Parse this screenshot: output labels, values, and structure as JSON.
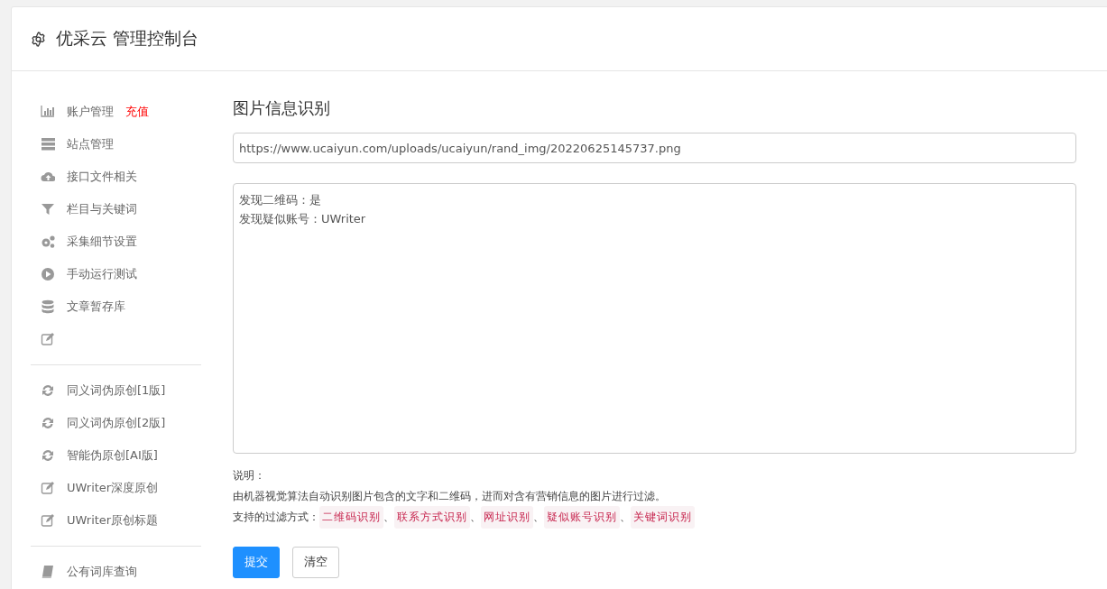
{
  "header": {
    "title": "优采云 管理控制台"
  },
  "sidebar": {
    "groups": [
      {
        "items": [
          {
            "kind": "link",
            "label": "账户管理",
            "badge": "充值"
          },
          {
            "kind": "link",
            "label": "站点管理"
          },
          {
            "kind": "link",
            "label": "接口文件相关"
          },
          {
            "kind": "link",
            "label": "栏目与关键词"
          },
          {
            "kind": "link",
            "label": "采集细节设置"
          },
          {
            "kind": "link",
            "label": "手动运行测试"
          },
          {
            "kind": "link",
            "label": "文章暂存库"
          },
          {
            "kind": "icon"
          }
        ]
      },
      {
        "items": [
          {
            "kind": "link",
            "label": "同义词伪原创[1版]"
          },
          {
            "kind": "link",
            "label": "同义词伪原创[2版]"
          },
          {
            "kind": "link",
            "label": "智能伪原创[AI版]"
          },
          {
            "kind": "link",
            "label": "UWriter深度原创"
          },
          {
            "kind": "link",
            "label": "UWriter原创标题"
          }
        ]
      },
      {
        "items": [
          {
            "kind": "link",
            "label": "公有词库查询"
          }
        ]
      }
    ]
  },
  "main": {
    "title": "图片信息识别",
    "url_field": {
      "value": "https://www.ucaiyun.com/uploads/ucaiyun/rand_img/20220625145737.png"
    },
    "result": {
      "lines": [
        "发现二维码：是",
        "发现疑似账号：UWriter"
      ]
    },
    "notes": {
      "heading": "说明：",
      "description": "由机器视觉算法自动识别图片包含的文字和二维码，进而对含有营销信息的图片进行过滤。",
      "methods_label": "支持的过滤方式：",
      "methods": [
        "二维码识别",
        "联系方式识别",
        "网址识别",
        "疑似账号识别",
        "关键词识别"
      ],
      "separator": "、"
    },
    "buttons": [
      {
        "label": "提交",
        "kind": "primary"
      },
      {
        "label": "清空",
        "kind": "default"
      }
    ]
  }
}
